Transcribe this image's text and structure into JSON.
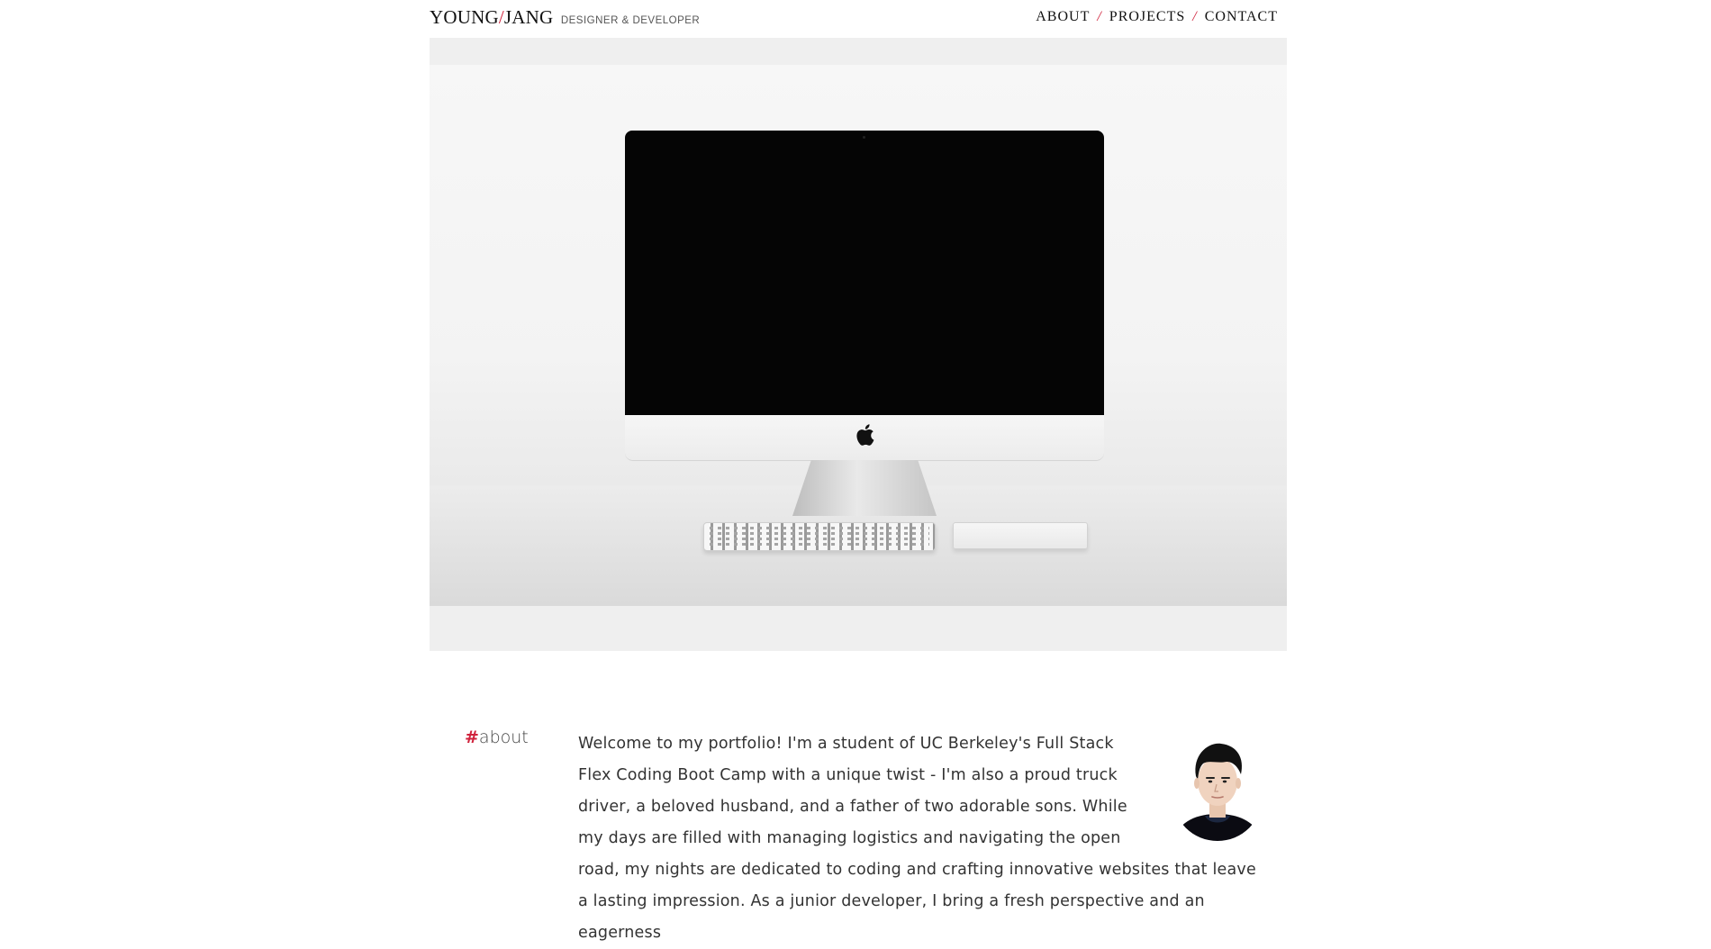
{
  "header": {
    "logo_first": "YOUNG",
    "logo_slash": "/",
    "logo_last": "JANG",
    "tagline": "DESIGNER & DEVELOPER",
    "nav": [
      "ABOUT",
      "PROJECTS",
      "CONTACT"
    ],
    "nav_separator": "/"
  },
  "about": {
    "heading_hash": "#",
    "heading_word": "about",
    "text": "Welcome to my portfolio! I'm a student of UC Berkeley's Full Stack Flex Coding Boot Camp with a unique twist - I'm also a proud truck driver, a beloved husband, and a father of two adorable sons. While my days are filled with managing logistics and navigating the open road, my nights are dedicated to coding and crafting innovative websites that leave a lasting impression. As a junior developer, I bring a fresh perspective and an eagerness"
  },
  "colors": {
    "accent": "#d0213b",
    "text": "#333333",
    "hero_bg": "#efefef"
  },
  "icons": [
    "apple-logo-icon"
  ]
}
